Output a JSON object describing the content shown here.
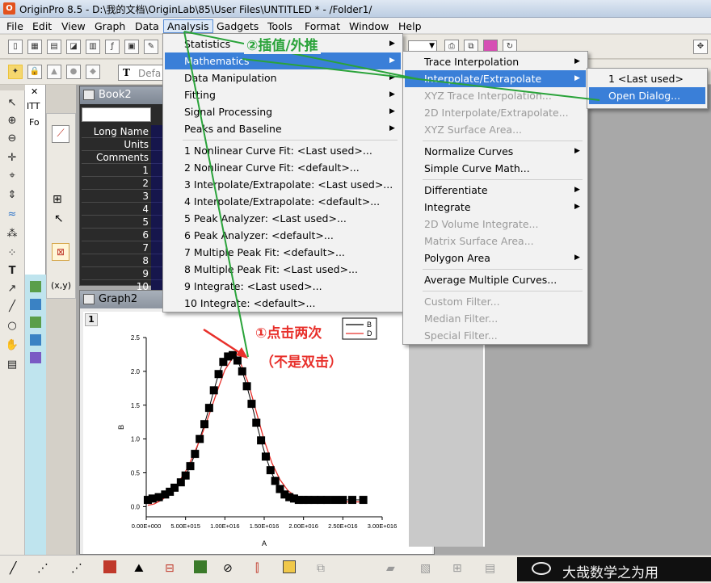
{
  "window": {
    "app_title": "OriginPro 8.5 - D:\\我的文档\\OriginLab\\85\\User Files\\UNTITLED * - /Folder1/"
  },
  "menubar": [
    "File",
    "Edit",
    "View",
    "Graph",
    "Data",
    "Analysis",
    "Gadgets",
    "Tools",
    "Format",
    "Window",
    "Help"
  ],
  "toolbar": {
    "font_name": "Defa"
  },
  "project_explorer": {
    "item1": "ITT",
    "item2": "Fo"
  },
  "book": {
    "title": "Book2",
    "row_headers": [
      "Long Name",
      "Units",
      "Comments",
      "1",
      "2",
      "3",
      "4",
      "5",
      "6",
      "7",
      "8",
      "9",
      "10"
    ]
  },
  "graph": {
    "title": "Graph2",
    "layer": "1",
    "ylabel": "B",
    "xlabel": "A",
    "legend": [
      "B",
      "D"
    ]
  },
  "chart_data": {
    "type": "scatter",
    "xlabel": "A",
    "ylabel": "B",
    "xlim": [
      0,
      3e+16
    ],
    "ylim": [
      -0.15,
      2.5
    ],
    "xticks": [
      "0.00E+000",
      "5.00E+015",
      "1.00E+016",
      "1.50E+016",
      "2.00E+016",
      "2.50E+016",
      "3.00E+016"
    ],
    "yticks": [
      "0.0",
      "0.5",
      "1.0",
      "1.5",
      "2.0",
      "2.5"
    ],
    "grid": false,
    "legend_position": "top-right",
    "series": [
      {
        "name": "B",
        "style": "line+symbol",
        "x": [
          200000000000000.0,
          800000000000000.0,
          1600000000000000.0,
          2400000000000000.0,
          3000000000000000.0,
          3600000000000000.0,
          4400000000000000.0,
          5000000000000000.0,
          5600000000000000.0,
          6200000000000000.0,
          6800000000000000.0,
          7400000000000000.0,
          8000000000000000.0,
          8600000000000000.0,
          9200000000000000.0,
          9800000000000000.0,
          1.04e+16,
          1.1e+16,
          1.16e+16,
          1.22e+16,
          1.28e+16,
          1.34e+16,
          1.4e+16,
          1.46e+16,
          1.52e+16,
          1.58e+16,
          1.64e+16,
          1.7e+16,
          1.76e+16,
          1.82e+16,
          1.88e+16,
          1.94e+16,
          2e+16,
          2.06e+16,
          2.14e+16,
          2.22e+16,
          2.3e+16,
          2.4e+16,
          2.5e+16,
          2.62e+16,
          2.76e+16
        ],
        "y": [
          0.1,
          0.12,
          0.14,
          0.18,
          0.22,
          0.28,
          0.36,
          0.46,
          0.6,
          0.78,
          1.0,
          1.22,
          1.46,
          1.72,
          1.96,
          2.14,
          2.22,
          2.24,
          2.16,
          2.0,
          1.78,
          1.52,
          1.24,
          0.98,
          0.74,
          0.54,
          0.38,
          0.26,
          0.18,
          0.14,
          0.12,
          0.1,
          0.1,
          0.1,
          0.1,
          0.1,
          0.1,
          0.1,
          0.1,
          0.1,
          0.1
        ]
      },
      {
        "name": "D",
        "style": "line",
        "color": "#e8302b",
        "x": [
          200000000000000.0,
          1000000000000000.0,
          2000000000000000.0,
          3000000000000000.0,
          4000000000000000.0,
          5000000000000000.0,
          6000000000000000.0,
          7000000000000000.0,
          8000000000000000.0,
          9000000000000000.0,
          1e+16,
          1.1e+16,
          1.2e+16,
          1.3e+16,
          1.4e+16,
          1.5e+16,
          1.6e+16,
          1.7e+16,
          1.8e+16,
          1.9e+16,
          2e+16,
          2.2e+16,
          2.4e+16,
          2.6e+16,
          2.76e+16
        ],
        "y": [
          0.02,
          0.04,
          0.1,
          0.2,
          0.34,
          0.52,
          0.76,
          1.04,
          1.36,
          1.7,
          2.02,
          2.2,
          2.12,
          1.82,
          1.4,
          0.98,
          0.64,
          0.4,
          0.24,
          0.15,
          0.1,
          0.08,
          0.07,
          0.07,
          0.07
        ]
      }
    ]
  },
  "analysis_menu": {
    "items": [
      {
        "label": "Statistics",
        "sub": true
      },
      {
        "label": "Mathematics",
        "sub": true,
        "hl": true
      },
      {
        "label": "Data Manipulation",
        "sub": true
      },
      {
        "label": "Fitting",
        "sub": true
      },
      {
        "label": "Signal Processing",
        "sub": true
      },
      {
        "label": "Peaks and Baseline",
        "sub": true
      },
      {
        "label": "1 Nonlinear Curve Fit: <Last used>..."
      },
      {
        "label": "2 Nonlinear Curve Fit: <default>..."
      },
      {
        "label": "3 Interpolate/Extrapolate: <Last used>..."
      },
      {
        "label": "4 Interpolate/Extrapolate: <default>..."
      },
      {
        "label": "5 Peak Analyzer: <Last used>..."
      },
      {
        "label": "6 Peak Analyzer: <default>..."
      },
      {
        "label": "7 Multiple Peak Fit: <default>..."
      },
      {
        "label": "8 Multiple Peak Fit: <Last used>..."
      },
      {
        "label": "9 Integrate: <Last used>..."
      },
      {
        "label": "10 Integrate: <default>..."
      }
    ]
  },
  "mathematics_menu": {
    "items": [
      {
        "label": "Trace Interpolation",
        "sub": true
      },
      {
        "label": "Interpolate/Extrapolate",
        "sub": true,
        "hl": true
      },
      {
        "label": "XYZ Trace Interpolation...",
        "disabled": true
      },
      {
        "label": "2D Interpolate/Extrapolate...",
        "disabled": true
      },
      {
        "label": "XYZ Surface Area...",
        "disabled": true
      },
      {
        "label": "Normalize Curves",
        "sub": true
      },
      {
        "label": "Simple Curve Math..."
      },
      {
        "label": "Differentiate",
        "sub": true
      },
      {
        "label": "Integrate",
        "sub": true
      },
      {
        "label": "2D Volume Integrate...",
        "disabled": true
      },
      {
        "label": "Matrix Surface Area...",
        "disabled": true
      },
      {
        "label": "Polygon Area",
        "sub": true
      },
      {
        "label": "Average Multiple Curves..."
      },
      {
        "label": "Custom Filter...",
        "disabled": true
      },
      {
        "label": "Median Filter...",
        "disabled": true
      },
      {
        "label": "Special Filter...",
        "disabled": true
      }
    ]
  },
  "interp_menu": {
    "items": [
      {
        "label": "1 <Last used>"
      },
      {
        "label": "Open Dialog...",
        "hl": true
      }
    ]
  },
  "annotations": {
    "step1": "①点击两次",
    "step1b": "（不是双击）",
    "step2": "②插值/外推"
  },
  "watermark": "大哉数学之为用",
  "colors": {
    "menu_highlight": "#3a7fd8",
    "annot_red": "#e8302b",
    "annot_green": "#2aa33a"
  }
}
